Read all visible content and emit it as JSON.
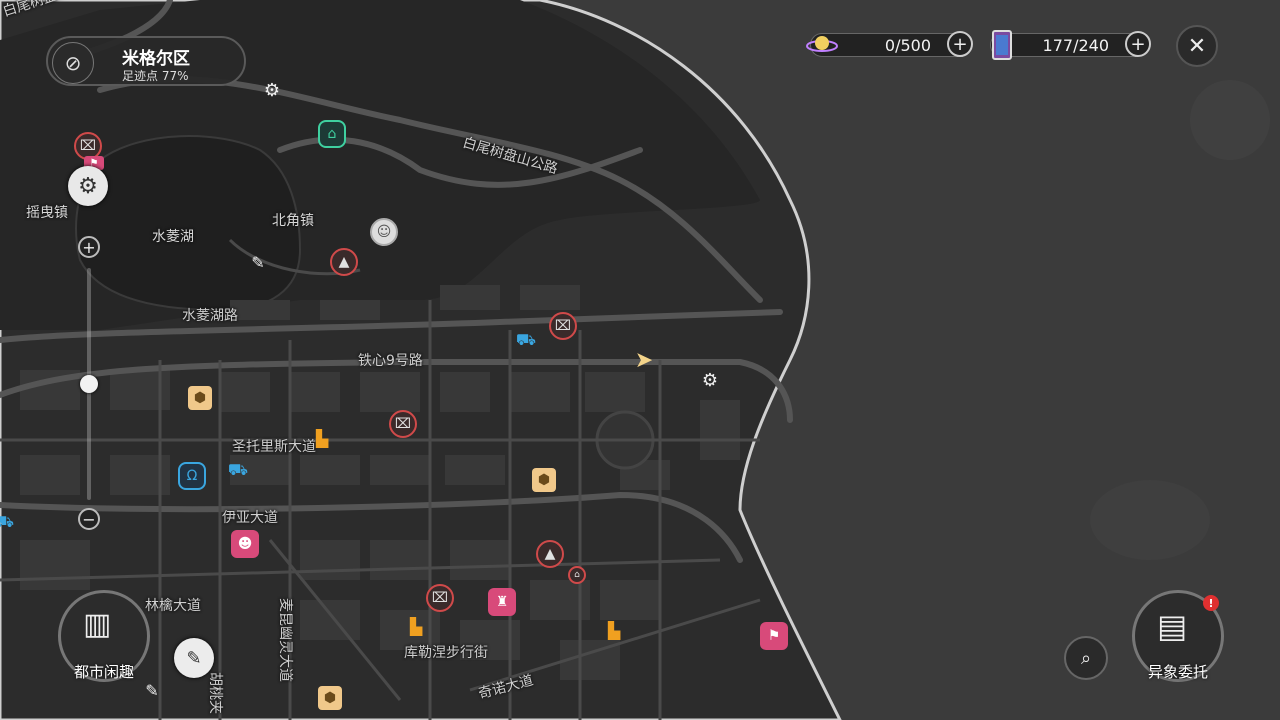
{
  "district": {
    "name": "米格尔区",
    "footprint_label": "足迹点",
    "footprint_value": "77%"
  },
  "currency": [
    {
      "icon": "planet-icon",
      "value": "0/500"
    },
    {
      "icon": "card-icon",
      "value": "177/240"
    }
  ],
  "zoom_level": 0.5,
  "map_labels": {
    "road_baiweishu_top": "白尾树盘山公路",
    "road_baiweishu": "白尾树盘山公路",
    "yaoye_town": "摇曳镇",
    "shuiling_lake": "水菱湖",
    "beijiao_town": "北角镇",
    "shuiling_road": "水菱湖路",
    "tiexin_road": "铁心9号路",
    "santuolis_ave": "圣托里斯大道",
    "yiya_ave": "伊亚大道",
    "linqin_ave": "林檎大道",
    "maikun_road": "麦昆幽灵大道",
    "kule_street": "库勒涅步行街",
    "qinuo_ave": "奇诺大道",
    "hutao_road": "胡桃夹"
  },
  "buttons": {
    "city_fun": "都市闲趣",
    "commission": "异象委托",
    "commission_badge": "!"
  },
  "colors": {
    "accent_red": "#d04a4a",
    "hex_gold": "#f0c88a",
    "pink": "#d84a7a",
    "teal": "#3fd0a0",
    "blue": "#3aa6e0"
  }
}
